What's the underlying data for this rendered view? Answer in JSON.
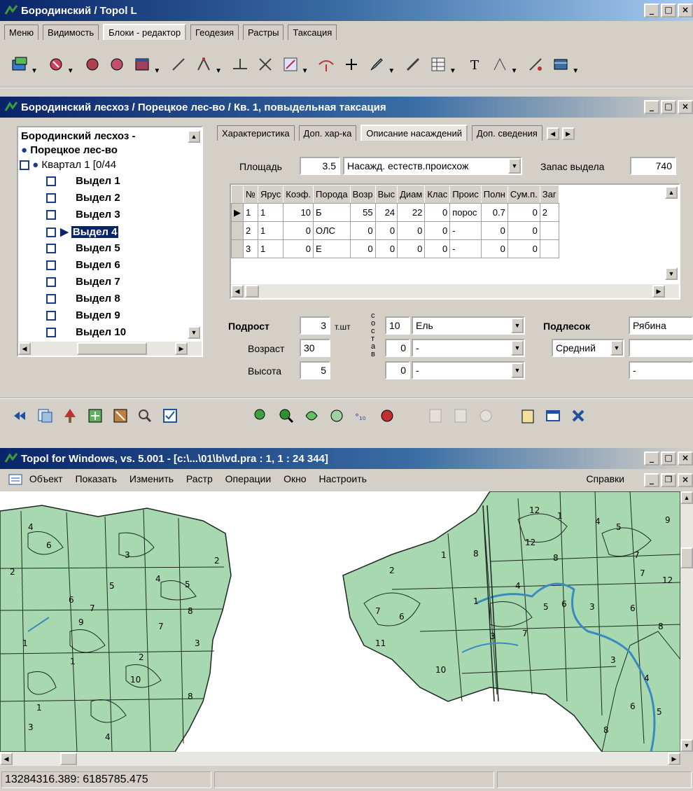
{
  "app_window": {
    "title": "Бородинский / Topol L",
    "tabs": [
      {
        "label": "Меню"
      },
      {
        "label": "Видимость"
      },
      {
        "label": "Блоки - редактор"
      },
      {
        "label": "Геодезия"
      },
      {
        "label": "Растры"
      },
      {
        "label": "Таксация"
      }
    ],
    "active_tab_index": 2
  },
  "taxation_window": {
    "title": "Бородинский лесхоз / Порецкое лес-во / Кв. 1, повыдельная таксация",
    "tree": {
      "root": "Бородинский лесхоз -",
      "forestry": "Порецкое лес-во",
      "quarter": "Квартал 1 [0/44",
      "plots": [
        "Выдел 1",
        "Выдел 2",
        "Выдел 3",
        "Выдел 4",
        "Выдел 5",
        "Выдел 6",
        "Выдел 7",
        "Выдел 8",
        "Выдел 9",
        "Выдел 10"
      ],
      "selected_plot": "Выдел 4"
    },
    "tabs": [
      "Характеристика",
      "Доп. хар-ка",
      "Описание насаждений",
      "Доп. сведения"
    ],
    "active_tab": "Описание насаждений",
    "area_label": "Площадь",
    "area_value": "3.5",
    "stand_type": "Насажд. естеств.происхож",
    "stock_label": "Запас выдела",
    "stock_value": "740",
    "table": {
      "columns": [
        "№",
        "Ярус",
        "Коэф.",
        "Порода",
        "Возр",
        "Выс",
        "Диам",
        "Клас",
        "Проис",
        "Полн",
        "Сум.п.",
        "Заг"
      ],
      "rows": [
        [
          "1",
          "1",
          "10",
          "Б",
          "55",
          "24",
          "22",
          "0",
          "порос",
          "0.7",
          "0",
          "2"
        ],
        [
          "2",
          "1",
          "0",
          "ОЛС",
          "0",
          "0",
          "0",
          "0",
          "-",
          "0",
          "0",
          ""
        ],
        [
          "3",
          "1",
          "0",
          "Е",
          "0",
          "0",
          "0",
          "0",
          "-",
          "0",
          "0",
          ""
        ]
      ]
    },
    "undergrowth": {
      "label": "Подрост",
      "count": "3",
      "unit": "т.шт",
      "age_label": "Возраст",
      "age": "30",
      "height_label": "Высота",
      "height": "5",
      "composition_label": "состав",
      "composition": [
        {
          "coef": "10",
          "species": "Ель"
        },
        {
          "coef": "0",
          "species": "-"
        },
        {
          "coef": "0",
          "species": "-"
        }
      ]
    },
    "underbrush": {
      "label": "Подлесок",
      "species": "Рябина",
      "density": "Средний",
      "extra": "-"
    }
  },
  "topol_window": {
    "title": "Topol for Windows, vs. 5.001 - [c:\\...\\01\\b\\vd.pra : 1, 1 : 24 344]",
    "menu": [
      "Объект",
      "Показать",
      "Изменить",
      "Растр",
      "Операции",
      "Окно",
      "Настроить"
    ],
    "help_menu": "Справки",
    "status_coords": "13284316.389: 6185785.475"
  },
  "map_labels": [
    "4",
    "6",
    "2",
    "5",
    "3",
    "4",
    "5",
    "2",
    "6",
    "7",
    "8",
    "9",
    "1",
    "1",
    "2",
    "3",
    "7",
    "10",
    "1",
    "4",
    "8",
    "2",
    "7",
    "6",
    "11",
    "10",
    "12",
    "1",
    "8",
    "1",
    "3",
    "4",
    "5",
    "6",
    "7",
    "8",
    "1",
    "12",
    "3",
    "4",
    "5",
    "6",
    "7",
    "8",
    "9",
    "12",
    "3",
    "4",
    "5",
    "6",
    "8",
    "7",
    "3"
  ],
  "colors": {
    "title_active": "#0a246a",
    "title_gradient_end": "#a6caf0",
    "map_fill": "#a8d8b0",
    "map_line": "#1a2a20",
    "river": "#3a8ac0"
  }
}
